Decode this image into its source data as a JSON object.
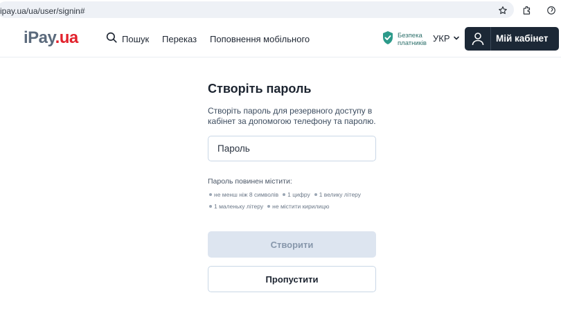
{
  "browser": {
    "url": "ipay.ua/ua/user/signin#",
    "icons": [
      "star-icon",
      "extensions-icon",
      "profile-icon"
    ]
  },
  "header": {
    "logo_part1": "iPay",
    "logo_part2": ".ua",
    "nav": {
      "search_label": "Пошук",
      "transfer_label": "Переказ",
      "topup_label": "Поповнення мобільного"
    },
    "safety_line1": "Безпека",
    "safety_line2": "платників",
    "language": "УКР",
    "cabinet_label": "Мій кабінет"
  },
  "form": {
    "title": "Створіть пароль",
    "subtitle": "Створіть пароль для резервного доступу в кабінет за допомогою телефону та паролю.",
    "password_placeholder": "Пароль",
    "requirements_title": "Пароль повинен містити:",
    "requirements_row1": [
      "не менш ніж 8 символів",
      "1 цифру",
      "1 велику літеру"
    ],
    "requirements_row2": [
      "1 маленьку літеру",
      "не містити кирилицю"
    ],
    "create_label": "Створити",
    "skip_label": "Пропустити"
  },
  "colors": {
    "brand_dark": "#1c2836",
    "brand_red": "#e2222c",
    "safety_green": "#2c9a8a",
    "disabled_button": "#dde5f0"
  }
}
